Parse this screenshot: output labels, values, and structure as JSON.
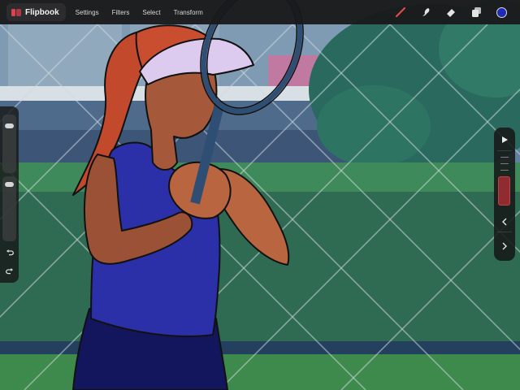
{
  "app": {
    "title": "Flipbook",
    "brand_color": "#e0414f"
  },
  "menu": {
    "items": [
      "Settings",
      "Filters",
      "Select",
      "Transform"
    ]
  },
  "tools": {
    "brush_icon": "brush-icon",
    "smudge_icon": "smudge-icon",
    "eraser_icon": "eraser-icon",
    "layers_icon": "layers-icon",
    "active_color": "#1e2bb5",
    "brush_color": "#e5484d"
  },
  "left_sidebar": {
    "brush_size_level": 0.12,
    "opacity_level": 0.05,
    "undo_icon": "undo-icon",
    "redo_icon": "redo-icon"
  },
  "right_sidebar": {
    "play_icon": "play-icon",
    "prev_icon": "chevron-left-icon",
    "next_icon": "chevron-right-icon",
    "frames_shown": 5
  },
  "canvas": {
    "content": "illustration",
    "palette": {
      "sky": "#5b7fa6",
      "hedge": "#2f6a55",
      "grass": "#3c8a4b",
      "shirt": "#2b2fa8",
      "skin": "#a5583a",
      "hair": "#c2492c",
      "visor": "#d9c9ea",
      "racket": "#2f4e74"
    }
  }
}
